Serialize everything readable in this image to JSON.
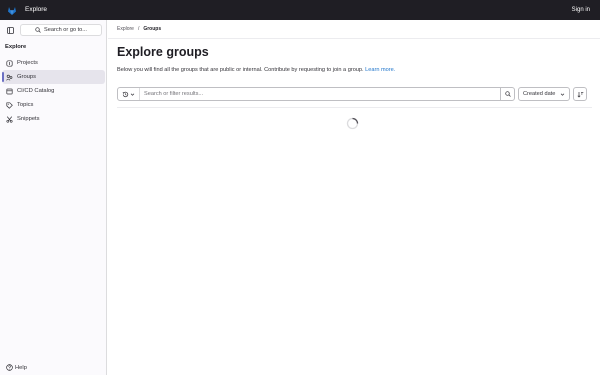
{
  "topbar": {
    "title": "Explore",
    "signin": "Sign in",
    "brand_color": "#1f75cb"
  },
  "sidebar": {
    "search_label": "Search or go to...",
    "section_title": "Explore",
    "items": [
      {
        "label": "Projects",
        "icon": "project-icon"
      },
      {
        "label": "Groups",
        "icon": "group-icon",
        "active": true
      },
      {
        "label": "CI/CD Catalog",
        "icon": "catalog-icon"
      },
      {
        "label": "Topics",
        "icon": "label-icon"
      },
      {
        "label": "Snippets",
        "icon": "snippet-icon"
      }
    ],
    "help_label": "Help"
  },
  "breadcrumb": {
    "root": "Explore",
    "separator": "/",
    "current": "Groups"
  },
  "page": {
    "title": "Explore groups",
    "description": "Below you will find all the groups that are public or internal. Contribute by requesting to join a group.",
    "learn_more": "Learn more."
  },
  "filter": {
    "placeholder": "Search or filter results...",
    "sort_label": "Created date"
  },
  "colors": {
    "accent": "#6b6fc3",
    "link": "#1f75cb"
  }
}
